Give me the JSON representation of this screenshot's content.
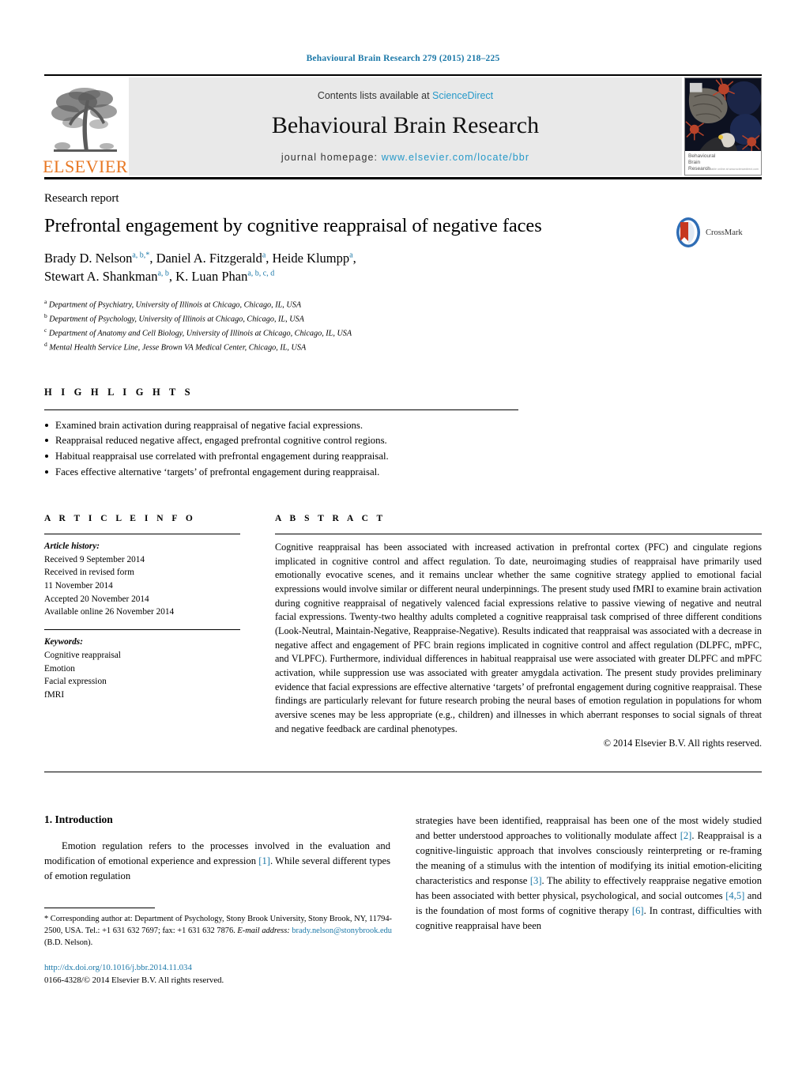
{
  "running_head": "Behavioural Brain Research 279 (2015) 218–225",
  "masthead": {
    "contents_prefix": "Contents lists available at ",
    "sciencedirect": "ScienceDirect",
    "journal_title": "Behavioural Brain Research",
    "homepage_prefix": "journal homepage: ",
    "homepage_url": "www.elsevier.com/locate/bbr",
    "publisher": "ELSEVIER",
    "cover_caption_line1": "Behavioural",
    "cover_caption_line2": "Brain",
    "cover_caption_line3": "Research",
    "cover_caption_tiny": "available online at www.sciencedirect.com"
  },
  "article": {
    "kind": "Research report",
    "title": "Prefrontal engagement by cognitive reappraisal of negative faces",
    "crossmark_label": "CrossMark",
    "authors_line1": "Brady D. Nelson",
    "authors_line1_sup1": "a, b,",
    "authors_line1_star": "*",
    "authors_line1_b": ", Daniel A. Fitzgerald",
    "authors_line1_sup2": "a",
    "authors_line1_c": ", Heide Klumpp",
    "authors_line1_sup3": "a",
    "authors_line1_d": ",",
    "authors_line2": "Stewart A. Shankman",
    "authors_line2_sup1": "a, b",
    "authors_line2_b": ", K. Luan Phan",
    "authors_line2_sup2": "a, b, c, d",
    "affiliations": [
      {
        "mark": "a",
        "text": "Department of Psychiatry, University of Illinois at Chicago, Chicago, IL, USA"
      },
      {
        "mark": "b",
        "text": "Department of Psychology, University of Illinois at Chicago, Chicago, IL, USA"
      },
      {
        "mark": "c",
        "text": "Department of Anatomy and Cell Biology, University of Illinois at Chicago, Chicago, IL, USA"
      },
      {
        "mark": "d",
        "text": "Mental Health Service Line, Jesse Brown VA Medical Center, Chicago, IL, USA"
      }
    ]
  },
  "highlights": {
    "heading": "H I G H L I G H T S",
    "items": [
      "Examined brain activation during reappraisal of negative facial expressions.",
      "Reappraisal reduced negative affect, engaged prefrontal cognitive control regions.",
      "Habitual reappraisal use correlated with prefrontal engagement during reappraisal.",
      "Faces effective alternative ‘targets’ of prefrontal engagement during reappraisal."
    ]
  },
  "article_info": {
    "heading": "A R T I C L E    I N F O",
    "history_label": "Article history:",
    "history": [
      "Received 9 September 2014",
      "Received in revised form",
      "11 November 2014",
      "Accepted 20 November 2014",
      "Available online 26 November 2014"
    ],
    "keywords_label": "Keywords:",
    "keywords": [
      "Cognitive reappraisal",
      "Emotion",
      "Facial expression",
      "fMRI"
    ]
  },
  "abstract": {
    "heading": "A B S T R A C T",
    "text": "Cognitive reappraisal has been associated with increased activation in prefrontal cortex (PFC) and cingulate regions implicated in cognitive control and affect regulation. To date, neuroimaging studies of reappraisal have primarily used emotionally evocative scenes, and it remains unclear whether the same cognitive strategy applied to emotional facial expressions would involve similar or different neural underpinnings. The present study used fMRI to examine brain activation during cognitive reappraisal of negatively valenced facial expressions relative to passive viewing of negative and neutral facial expressions. Twenty-two healthy adults completed a cognitive reappraisal task comprised of three different conditions (Look-Neutral, Maintain-Negative, Reappraise-Negative). Results indicated that reappraisal was associated with a decrease in negative affect and engagement of PFC brain regions implicated in cognitive control and affect regulation (DLPFC, mPFC, and VLPFC). Furthermore, individual differences in habitual reappraisal use were associated with greater DLPFC and mPFC activation, while suppression use was associated with greater amygdala activation. The present study provides preliminary evidence that facial expressions are effective alternative ‘targets’ of prefrontal engagement during cognitive reappraisal. These findings are particularly relevant for future research probing the neural bases of emotion regulation in populations for whom aversive scenes may be less appropriate (e.g., children) and illnesses in which aberrant responses to social signals of threat and negative feedback are cardinal phenotypes.",
    "copyright": "© 2014 Elsevier B.V. All rights reserved."
  },
  "introduction": {
    "heading": "1. Introduction",
    "left_para_a": "Emotion regulation refers to the processes involved in the evaluation and modification of emotional experience and expression ",
    "left_ref_1": "[1]",
    "left_para_b": ". While several different types of emotion regulation",
    "right_para_a": "strategies have been identified, reappraisal has been one of the most widely studied and better understood approaches to volitionally modulate affect ",
    "right_ref_2": "[2]",
    "right_para_b": ". Reappraisal is a cognitive-linguistic approach that involves consciously reinterpreting or re-framing the meaning of a stimulus with the intention of modifying its initial emotion-eliciting characteristics and response ",
    "right_ref_3": "[3]",
    "right_para_c": ". The ability to effectively reappraise negative emotion has been associated with better physical, psychological, and social outcomes ",
    "right_ref_45": "[4,5]",
    "right_para_d": " and is the foundation of most forms of cognitive therapy ",
    "right_ref_6": "[6]",
    "right_para_e": ". In contrast, difficulties with cognitive reappraisal have been"
  },
  "footnotes": {
    "corresponding_star": "*",
    "corresponding_text": " Corresponding author at: Department of Psychology, Stony Brook University, Stony Brook, NY, 11794-2500, USA. Tel.: +1 631 632 7697; fax: +1 631 632 7876.",
    "email_label": "E-mail address:",
    "email": "brady.nelson@stonybrook.edu",
    "email_suffix": " (B.D. Nelson).",
    "doi": "http://dx.doi.org/10.1016/j.bbr.2014.11.034",
    "issn_line": "0166-4328/© 2014 Elsevier B.V. All rights reserved."
  },
  "colors": {
    "link": "#1b78a8",
    "sciencedirect": "#2699c9",
    "elsevier_orange": "#e87722",
    "masthead_bg": "#e9e9e9"
  }
}
